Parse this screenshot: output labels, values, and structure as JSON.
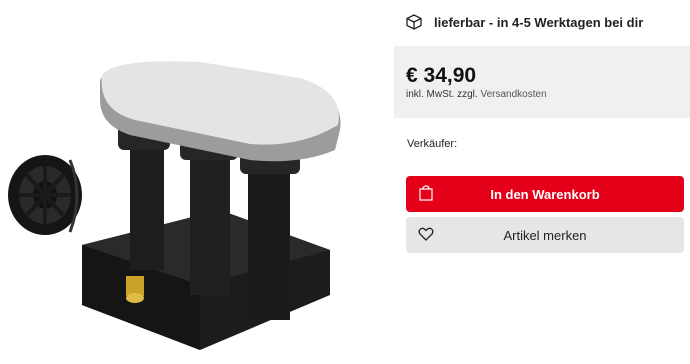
{
  "delivery": {
    "icon": "package-icon",
    "text": "lieferbar - in 4-5 Werktagen bei dir"
  },
  "price": {
    "amount": "€ 34,90",
    "tax_note": "inkl. MwSt. zzgl.",
    "shipping_link": "Versandkosten"
  },
  "seller": {
    "label": "Verkäufer:"
  },
  "actions": {
    "add_to_cart": {
      "label": "In den Warenkorb",
      "icon": "cart-icon",
      "color": "#e50019"
    },
    "watchlist": {
      "label": "Artikel merken",
      "icon": "heart-icon"
    }
  },
  "product": {
    "image": "satellite-lnb-product-image"
  }
}
